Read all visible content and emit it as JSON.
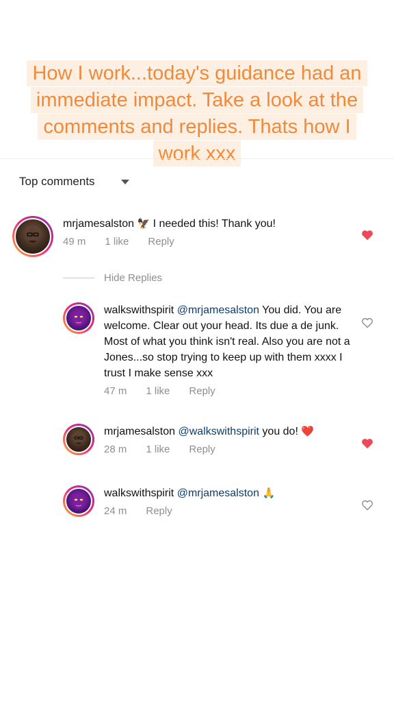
{
  "banner": {
    "text": "How I work...today's guidance had an immediate impact.  Take a look at the comments and replies.  Thats how I work xxx"
  },
  "sort": {
    "label": "Top comments"
  },
  "hide_replies": {
    "label": "Hide Replies"
  },
  "comments": [
    {
      "username": "mrjamesalston",
      "emoji": "🦅",
      "text": " I needed this! Thank you!",
      "time": "49 m",
      "likes": "1 like",
      "reply": "Reply",
      "liked": true
    },
    {
      "username": "walkswithspirit",
      "mention": "@mrjamesalston",
      "text": " You did. You are welcome.  Clear out your head.  Its due a de junk.  Most of what you think isn't real.  Also you are not a Jones...so stop trying to keep up with them xxxx I trust I make sense xxx",
      "time": "47 m",
      "likes": "1 like",
      "reply": "Reply",
      "liked": false
    },
    {
      "username": "mrjamesalston",
      "mention": "@walkswithspirit",
      "text": " you do! ",
      "emoji": "❤️",
      "time": "28 m",
      "likes": "1 like",
      "reply": "Reply",
      "liked": true
    },
    {
      "username": "walkswithspirit",
      "mention": "@mrjamesalston",
      "emoji": "🙏",
      "time": "24 m",
      "reply": "Reply",
      "liked": false
    }
  ],
  "colors": {
    "banner_text": "#f08a3a",
    "banner_bg": "#fdf0e3",
    "heart_liked": "#ed4956",
    "mention": "#0d3d69"
  }
}
